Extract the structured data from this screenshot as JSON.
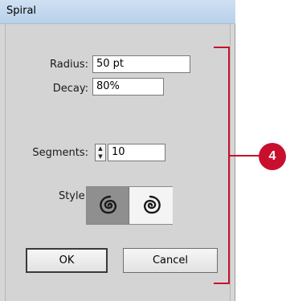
{
  "window": {
    "title": "Spiral"
  },
  "form": {
    "radius_label": "Radius:",
    "radius_value": "50 pt",
    "decay_label": "Decay:",
    "decay_value": "80%",
    "segments_label": "Segments:",
    "segments_value": "10",
    "style_label": "Style:",
    "style_options": [
      "counterclockwise-spiral",
      "clockwise-spiral"
    ],
    "style_selected": "counterclockwise-spiral"
  },
  "buttons": {
    "ok_label": "OK",
    "cancel_label": "Cancel"
  },
  "annotation": {
    "callout_number": "4",
    "color": "#c8102e"
  }
}
